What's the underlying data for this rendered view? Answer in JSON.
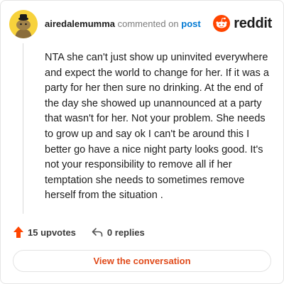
{
  "header": {
    "username": "airedalemumma",
    "commented_text": "commented on",
    "post_link": "post",
    "logo_text": "reddit"
  },
  "comment": {
    "body": "NTA she can't just show up uninvited everywhere and expect the world to change for her. If it was a party for her then sure no drinking. At the end of the day she showed up unannounced at a party that wasn't for her. Not your problem. She needs to grow up and say ok I can't be around this I better go have a nice night party looks good. It's not your responsibility to remove all if her temptation she needs to sometimes remove herself from the situation ."
  },
  "actions": {
    "upvotes_label": "15 upvotes",
    "replies_label": "0 replies"
  },
  "footer": {
    "button_label": "View the conversation"
  },
  "colors": {
    "accent": "#ff4500",
    "link": "#0079d3",
    "avatar_bg": "#f7d23c"
  },
  "icons": {
    "avatar": "snoo-avatar-icon",
    "logo": "reddit-logo-icon",
    "upvote": "upvote-arrow-icon",
    "reply": "reply-arrow-icon"
  }
}
